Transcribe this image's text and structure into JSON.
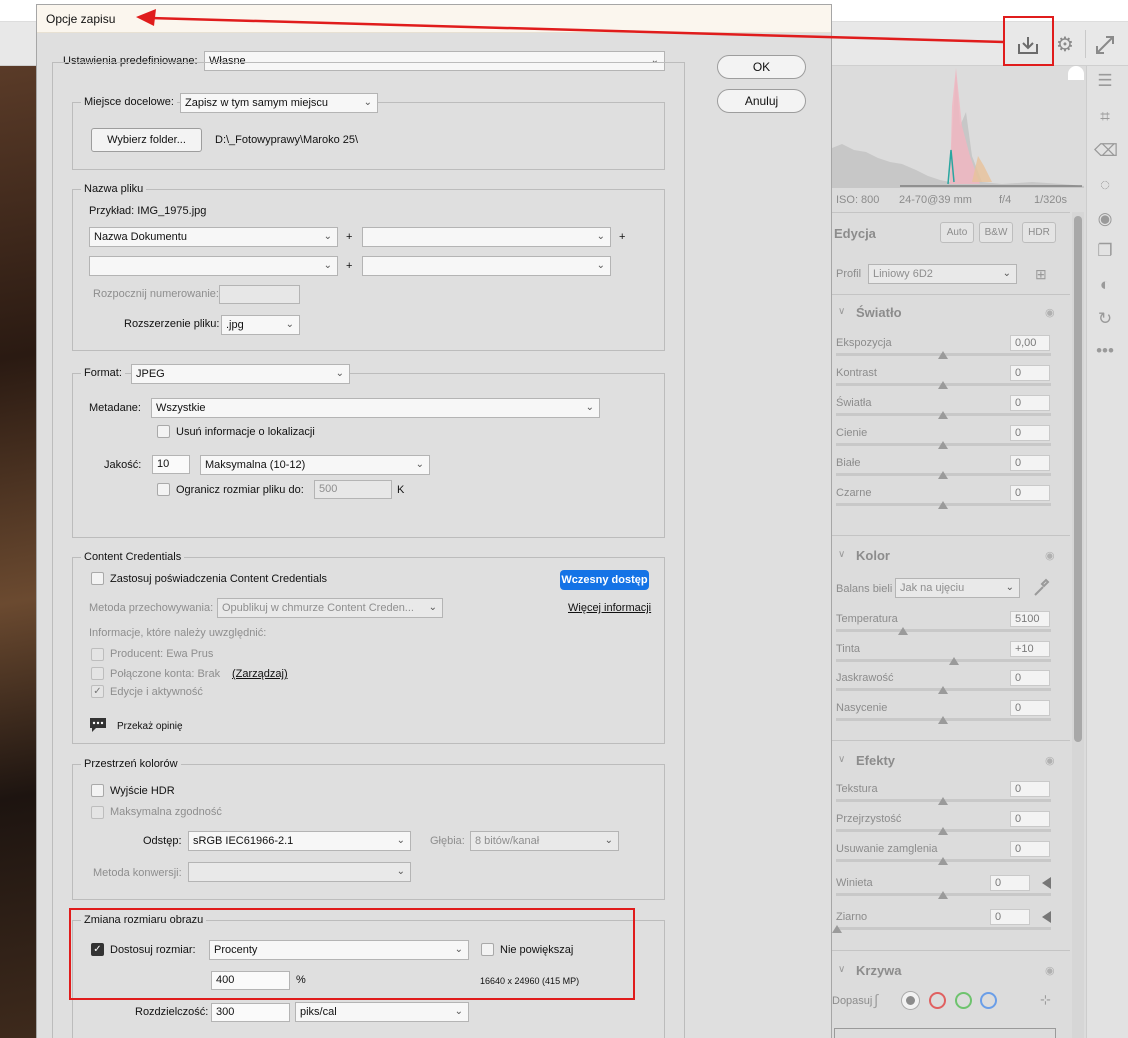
{
  "dialog": {
    "title": "Opcje zapisu",
    "ok": "OK",
    "cancel": "Anuluj",
    "preset_label": "Ustawienia predefiniowane:",
    "preset_value": "Własne",
    "destination": {
      "group": "Miejsce docelowe:",
      "value": "Zapisz w tym samym miejscu",
      "choose_folder": "Wybierz folder...",
      "path": "D:\\_Fotowyprawy\\Maroko 25\\"
    },
    "filename": {
      "group": "Nazwa pliku",
      "example": "Przykład:  IMG_1975.jpg",
      "field1": "Nazwa Dokumentu",
      "field2": "",
      "field3": "",
      "field4": "",
      "plus": "+",
      "numbering_label": "Rozpocznij numerowanie:",
      "numbering_value": "",
      "ext_label": "Rozszerzenie pliku:",
      "ext_value": ".jpg"
    },
    "format": {
      "label": "Format:",
      "value": "JPEG",
      "metadata_label": "Metadane:",
      "metadata_value": "Wszystkie",
      "remove_location": "Usuń informacje o lokalizacji",
      "quality_label": "Jakość:",
      "quality_value": "10",
      "quality_preset": "Maksymalna  (10-12)",
      "limit_label": "Ogranicz rozmiar pliku do:",
      "limit_value": "500",
      "limit_unit": "K"
    },
    "credentials": {
      "group": "Content Credentials",
      "apply": "Zastosuj poświadczenia Content Credentials",
      "early_access": "Wczesny dostęp",
      "storage_label": "Metoda przechowywania:",
      "storage_value": "Opublikuj w chmurze Content Creden...",
      "more_info": "Więcej informacji",
      "include_label": "Informacje, które należy uwzględnić:",
      "producer": "Producent: Ewa Prus",
      "accounts": "Połączone konta: Brak",
      "manage": "(Zarządzaj)",
      "edits": "Edycje i aktywność",
      "feedback": "Przekaż opinię"
    },
    "color_space": {
      "group": "Przestrzeń kolorów",
      "hdr": "Wyjście HDR",
      "max_compat": "Maksymalna zgodność",
      "space_label": "Odstęp:",
      "space_value": "sRGB IEC61966-2.1",
      "depth_label": "Głębia:",
      "depth_value": "8 bitów/kanał",
      "conv_label": "Metoda konwersji:",
      "conv_value": ""
    },
    "resize": {
      "group": "Zmiana rozmiaru obrazu",
      "fit_label": "Dostosuj rozmiar:",
      "fit_value": "Procenty",
      "no_enlarge": "Nie powiększaj",
      "percent_value": "400",
      "percent_unit": "%",
      "dims": "16640 x 24960 (415 MP)",
      "res_label": "Rozdzielczość:",
      "res_value": "300",
      "res_unit": "piks/cal"
    }
  },
  "panel": {
    "exif": {
      "iso": "ISO: 800",
      "lens": "24-70@39 mm",
      "aperture": "f/4",
      "shutter": "1/320s"
    },
    "edit_title": "Edycja",
    "auto": "Auto",
    "bw": "B&W",
    "hdr": "HDR",
    "profile_label": "Profil",
    "profile_value": "Liniowy 6D2",
    "light": {
      "title": "Światło",
      "sliders": [
        {
          "label": "Ekspozycja",
          "value": "0,00"
        },
        {
          "label": "Kontrast",
          "value": "0"
        },
        {
          "label": "Światła",
          "value": "0"
        },
        {
          "label": "Cienie",
          "value": "0"
        },
        {
          "label": "Białe",
          "value": "0"
        },
        {
          "label": "Czarne",
          "value": "0"
        }
      ]
    },
    "color": {
      "title": "Kolor",
      "wb_label": "Balans bieli",
      "wb_value": "Jak na ujęciu",
      "sliders": [
        {
          "label": "Temperatura",
          "value": "5100"
        },
        {
          "label": "Tinta",
          "value": "+10"
        },
        {
          "label": "Jaskrawość",
          "value": "0"
        },
        {
          "label": "Nasycenie",
          "value": "0"
        }
      ]
    },
    "effects": {
      "title": "Efekty",
      "sliders": [
        {
          "label": "Tekstura",
          "value": "0"
        },
        {
          "label": "Przejrzystość",
          "value": "0"
        },
        {
          "label": "Usuwanie zamglenia",
          "value": "0"
        },
        {
          "label": "Winieta",
          "value": "0"
        },
        {
          "label": "Ziarno",
          "value": "0"
        }
      ]
    },
    "curves": {
      "title": "Krzywa",
      "adjust_label": "Dopasuj"
    }
  }
}
